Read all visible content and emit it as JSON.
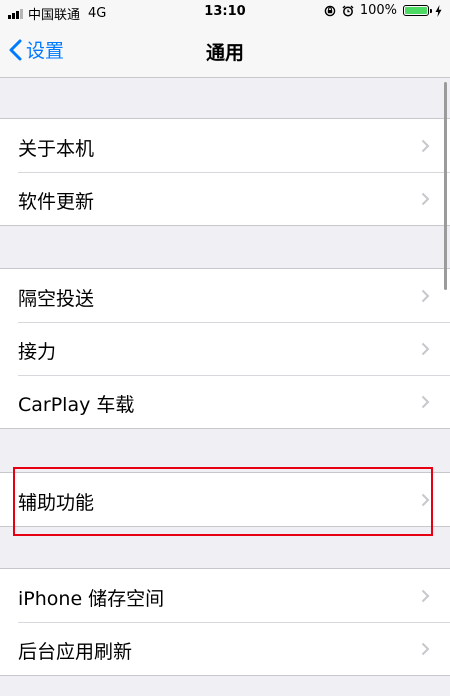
{
  "status_bar": {
    "carrier": "中国联通",
    "network": "4G",
    "time": "13:10",
    "battery_percent": "100%",
    "icons": [
      "signal-icon",
      "rotation-lock-icon",
      "alarm-icon",
      "battery-icon",
      "charging-icon"
    ]
  },
  "nav": {
    "back_label": "设置",
    "title": "通用"
  },
  "groups": [
    {
      "items": [
        "关于本机",
        "软件更新"
      ]
    },
    {
      "items": [
        "隔空投送",
        "接力",
        "CarPlay 车载"
      ]
    },
    {
      "items": [
        "辅助功能"
      ]
    },
    {
      "items": [
        "iPhone 储存空间",
        "后台应用刷新"
      ]
    }
  ],
  "highlighted_item": "辅助功能",
  "colors": {
    "accent": "#007aff",
    "highlight_border": "#e60012",
    "background": "#efeff4",
    "battery": "#4cd964"
  }
}
